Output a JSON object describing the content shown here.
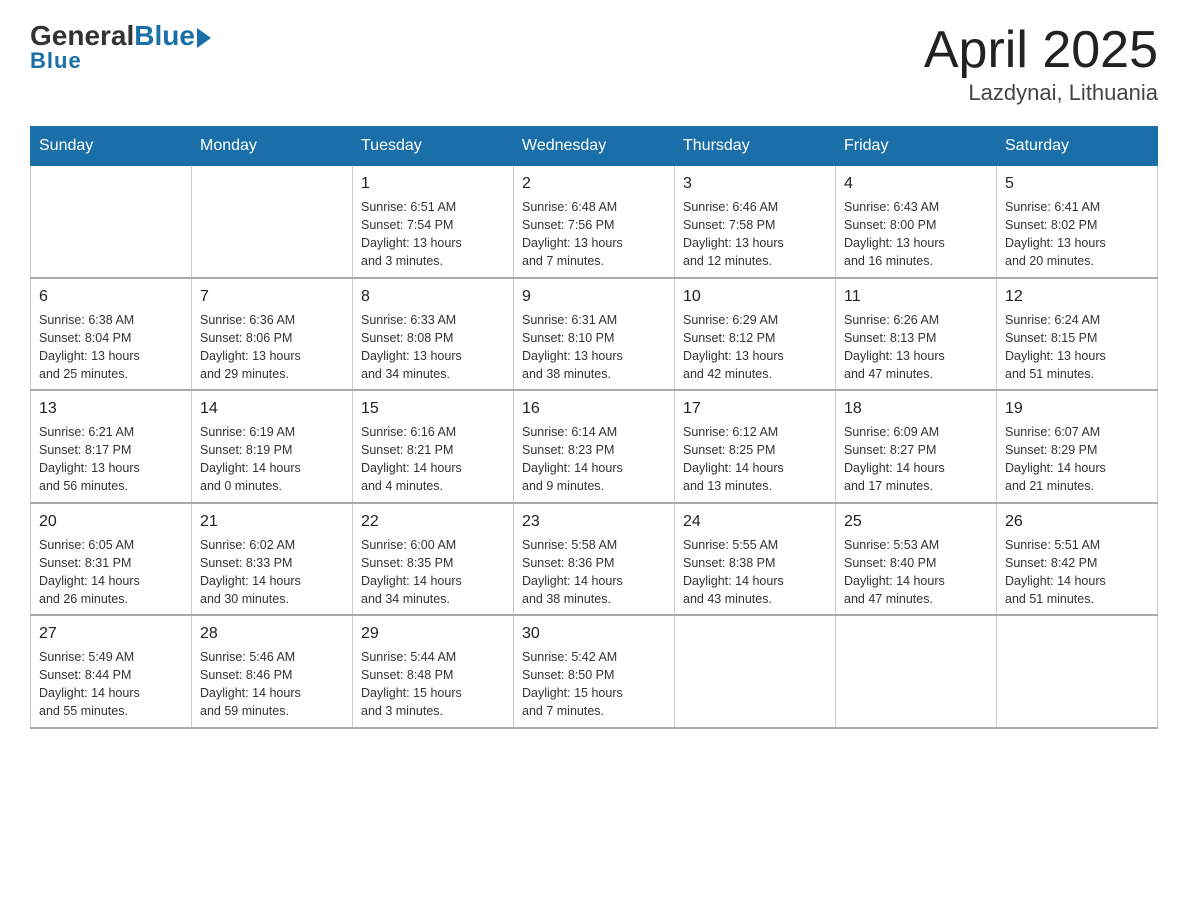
{
  "header": {
    "logo_general": "General",
    "logo_blue": "Blue",
    "title": "April 2025",
    "subtitle": "Lazdynai, Lithuania"
  },
  "weekdays": [
    "Sunday",
    "Monday",
    "Tuesday",
    "Wednesday",
    "Thursday",
    "Friday",
    "Saturday"
  ],
  "weeks": [
    [
      {
        "day": "",
        "info": ""
      },
      {
        "day": "",
        "info": ""
      },
      {
        "day": "1",
        "info": "Sunrise: 6:51 AM\nSunset: 7:54 PM\nDaylight: 13 hours\nand 3 minutes."
      },
      {
        "day": "2",
        "info": "Sunrise: 6:48 AM\nSunset: 7:56 PM\nDaylight: 13 hours\nand 7 minutes."
      },
      {
        "day": "3",
        "info": "Sunrise: 6:46 AM\nSunset: 7:58 PM\nDaylight: 13 hours\nand 12 minutes."
      },
      {
        "day": "4",
        "info": "Sunrise: 6:43 AM\nSunset: 8:00 PM\nDaylight: 13 hours\nand 16 minutes."
      },
      {
        "day": "5",
        "info": "Sunrise: 6:41 AM\nSunset: 8:02 PM\nDaylight: 13 hours\nand 20 minutes."
      }
    ],
    [
      {
        "day": "6",
        "info": "Sunrise: 6:38 AM\nSunset: 8:04 PM\nDaylight: 13 hours\nand 25 minutes."
      },
      {
        "day": "7",
        "info": "Sunrise: 6:36 AM\nSunset: 8:06 PM\nDaylight: 13 hours\nand 29 minutes."
      },
      {
        "day": "8",
        "info": "Sunrise: 6:33 AM\nSunset: 8:08 PM\nDaylight: 13 hours\nand 34 minutes."
      },
      {
        "day": "9",
        "info": "Sunrise: 6:31 AM\nSunset: 8:10 PM\nDaylight: 13 hours\nand 38 minutes."
      },
      {
        "day": "10",
        "info": "Sunrise: 6:29 AM\nSunset: 8:12 PM\nDaylight: 13 hours\nand 42 minutes."
      },
      {
        "day": "11",
        "info": "Sunrise: 6:26 AM\nSunset: 8:13 PM\nDaylight: 13 hours\nand 47 minutes."
      },
      {
        "day": "12",
        "info": "Sunrise: 6:24 AM\nSunset: 8:15 PM\nDaylight: 13 hours\nand 51 minutes."
      }
    ],
    [
      {
        "day": "13",
        "info": "Sunrise: 6:21 AM\nSunset: 8:17 PM\nDaylight: 13 hours\nand 56 minutes."
      },
      {
        "day": "14",
        "info": "Sunrise: 6:19 AM\nSunset: 8:19 PM\nDaylight: 14 hours\nand 0 minutes."
      },
      {
        "day": "15",
        "info": "Sunrise: 6:16 AM\nSunset: 8:21 PM\nDaylight: 14 hours\nand 4 minutes."
      },
      {
        "day": "16",
        "info": "Sunrise: 6:14 AM\nSunset: 8:23 PM\nDaylight: 14 hours\nand 9 minutes."
      },
      {
        "day": "17",
        "info": "Sunrise: 6:12 AM\nSunset: 8:25 PM\nDaylight: 14 hours\nand 13 minutes."
      },
      {
        "day": "18",
        "info": "Sunrise: 6:09 AM\nSunset: 8:27 PM\nDaylight: 14 hours\nand 17 minutes."
      },
      {
        "day": "19",
        "info": "Sunrise: 6:07 AM\nSunset: 8:29 PM\nDaylight: 14 hours\nand 21 minutes."
      }
    ],
    [
      {
        "day": "20",
        "info": "Sunrise: 6:05 AM\nSunset: 8:31 PM\nDaylight: 14 hours\nand 26 minutes."
      },
      {
        "day": "21",
        "info": "Sunrise: 6:02 AM\nSunset: 8:33 PM\nDaylight: 14 hours\nand 30 minutes."
      },
      {
        "day": "22",
        "info": "Sunrise: 6:00 AM\nSunset: 8:35 PM\nDaylight: 14 hours\nand 34 minutes."
      },
      {
        "day": "23",
        "info": "Sunrise: 5:58 AM\nSunset: 8:36 PM\nDaylight: 14 hours\nand 38 minutes."
      },
      {
        "day": "24",
        "info": "Sunrise: 5:55 AM\nSunset: 8:38 PM\nDaylight: 14 hours\nand 43 minutes."
      },
      {
        "day": "25",
        "info": "Sunrise: 5:53 AM\nSunset: 8:40 PM\nDaylight: 14 hours\nand 47 minutes."
      },
      {
        "day": "26",
        "info": "Sunrise: 5:51 AM\nSunset: 8:42 PM\nDaylight: 14 hours\nand 51 minutes."
      }
    ],
    [
      {
        "day": "27",
        "info": "Sunrise: 5:49 AM\nSunset: 8:44 PM\nDaylight: 14 hours\nand 55 minutes."
      },
      {
        "day": "28",
        "info": "Sunrise: 5:46 AM\nSunset: 8:46 PM\nDaylight: 14 hours\nand 59 minutes."
      },
      {
        "day": "29",
        "info": "Sunrise: 5:44 AM\nSunset: 8:48 PM\nDaylight: 15 hours\nand 3 minutes."
      },
      {
        "day": "30",
        "info": "Sunrise: 5:42 AM\nSunset: 8:50 PM\nDaylight: 15 hours\nand 7 minutes."
      },
      {
        "day": "",
        "info": ""
      },
      {
        "day": "",
        "info": ""
      },
      {
        "day": "",
        "info": ""
      }
    ]
  ]
}
